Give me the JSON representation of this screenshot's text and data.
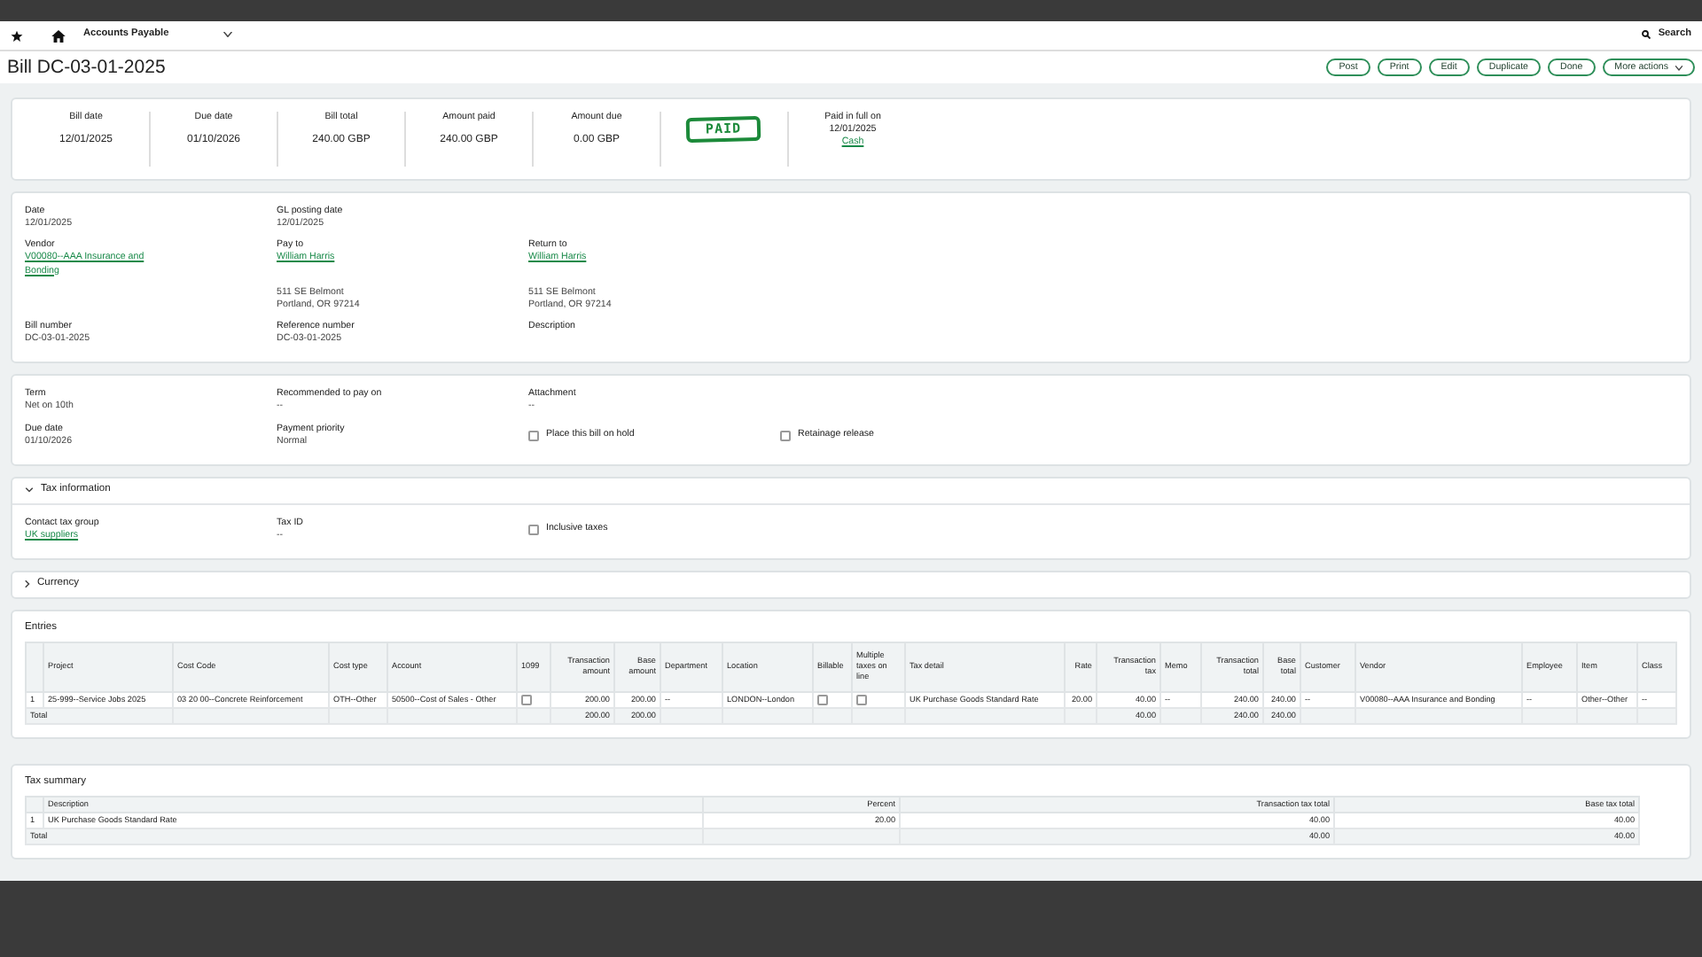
{
  "nav": {
    "module": "Accounts Payable",
    "search": "Search"
  },
  "title": "Bill DC-03-01-2025",
  "actions": [
    {
      "label": "Post",
      "kind": "button"
    },
    {
      "label": "Print",
      "kind": "button"
    },
    {
      "label": "Edit",
      "kind": "button"
    },
    {
      "label": "Duplicate",
      "kind": "button"
    },
    {
      "label": "Done",
      "kind": "button"
    },
    {
      "label": "More actions",
      "kind": "dropdown"
    }
  ],
  "summary": {
    "items": [
      {
        "label": "Bill date",
        "value": "12/01/2025"
      },
      {
        "label": "Due date",
        "value": "01/10/2026"
      },
      {
        "label": "Bill total",
        "value": "240.00 GBP"
      },
      {
        "label": "Amount paid",
        "value": "240.00 GBP"
      },
      {
        "label": "Amount due",
        "value": "0.00 GBP"
      }
    ],
    "stamp": "PAID",
    "paid": {
      "label": "Paid in full on",
      "date": "12/01/2025",
      "method": "Cash"
    }
  },
  "sections": [
    {
      "rows": [
        [
          {
            "kind": "text",
            "label": "Date",
            "values": [
              "12/01/2025"
            ]
          },
          {
            "kind": "text",
            "label": "GL posting date",
            "values": [
              "12/01/2025"
            ]
          }
        ],
        [
          {
            "kind": "link",
            "label": "Vendor",
            "values": [
              "V00080--AAA Insurance and Bonding"
            ]
          },
          {
            "kind": "link",
            "label": "Pay to",
            "values": [
              "William Harris"
            ]
          },
          {
            "kind": "link",
            "label": "Return to",
            "values": [
              "William Harris"
            ]
          }
        ],
        [
          null,
          {
            "kind": "text",
            "values": [
              "511 SE Belmont",
              "Portland, OR 97214"
            ]
          },
          {
            "kind": "text",
            "values": [
              "511 SE Belmont",
              "Portland, OR 97214"
            ]
          }
        ],
        [
          {
            "kind": "text",
            "label": "Bill number",
            "values": [
              "DC-03-01-2025"
            ]
          },
          {
            "kind": "text",
            "label": "Reference number",
            "values": [
              "DC-03-01-2025"
            ]
          },
          {
            "kind": "text",
            "label": "Description"
          }
        ]
      ]
    },
    {
      "rows": [
        [
          {
            "kind": "text",
            "label": "Term",
            "values": [
              "Net on 10th"
            ]
          },
          {
            "kind": "text",
            "label": "Recommended to pay on",
            "values": [
              "--"
            ]
          },
          {
            "kind": "text",
            "label": "Attachment",
            "values": [
              "--"
            ]
          }
        ],
        [
          {
            "kind": "text",
            "label": "Due date",
            "values": [
              "01/10/2026"
            ]
          },
          {
            "kind": "text",
            "label": "Payment priority",
            "values": [
              "Normal"
            ]
          },
          {
            "kind": "checkbox",
            "label": "Place this bill on hold",
            "checked": false
          },
          {
            "kind": "checkbox",
            "label": "Retainage release",
            "checked": false
          }
        ]
      ]
    },
    {
      "title": "Tax information",
      "expanded": true,
      "rows": [
        [
          {
            "kind": "link",
            "label": "Contact tax group",
            "values": [
              "UK suppliers"
            ]
          },
          {
            "kind": "text",
            "label": "Tax ID",
            "values": [
              "--"
            ]
          },
          {
            "kind": "checkbox",
            "label": "Inclusive taxes",
            "checked": false
          }
        ]
      ]
    },
    {
      "title": "Currency",
      "expanded": false
    }
  ],
  "entries": {
    "title": "Entries",
    "columns": [
      "Project",
      "Cost Code",
      "Cost type",
      "Account",
      "1099",
      "Transaction amount",
      "Base amount",
      "Department",
      "Location",
      "Billable",
      "Multiple taxes on line",
      "Tax detail",
      "Rate",
      "Transaction tax",
      "Memo",
      "Transaction total",
      "Base total",
      "Customer",
      "Vendor",
      "Employee",
      "Item",
      "Class"
    ],
    "rows": [
      {
        "number": "1",
        "cells": [
          "25-999--Service Jobs 2025",
          "03 20 00--Concrete Reinforcement",
          "OTH--Other",
          "50500--Cost of Sales - Other",
          false,
          "200.00",
          "200.00",
          "--",
          "LONDON--London",
          false,
          false,
          "UK Purchase Goods Standard Rate",
          "20.00",
          "40.00",
          "--",
          "240.00",
          "240.00",
          "--",
          "V00080--AAA Insurance and Bonding",
          "--",
          "Other--Other",
          "--"
        ]
      }
    ],
    "total": {
      "label": "Total",
      "cells": [
        null,
        null,
        null,
        null,
        null,
        "200.00",
        "200.00",
        null,
        null,
        null,
        null,
        null,
        null,
        "40.00",
        null,
        "240.00",
        "240.00",
        null,
        null,
        null,
        null,
        null
      ]
    }
  },
  "tax_summary": {
    "title": "Tax summary",
    "columns": [
      "Description",
      "Percent",
      "Transaction tax total",
      "Base tax total"
    ],
    "rows": [
      {
        "number": "1",
        "cells": [
          "UK Purchase Goods Standard Rate",
          "20.00",
          "40.00",
          "40.00"
        ]
      }
    ],
    "total": {
      "label": "Total",
      "cells": [
        null,
        null,
        "40.00",
        "40.00"
      ]
    }
  }
}
